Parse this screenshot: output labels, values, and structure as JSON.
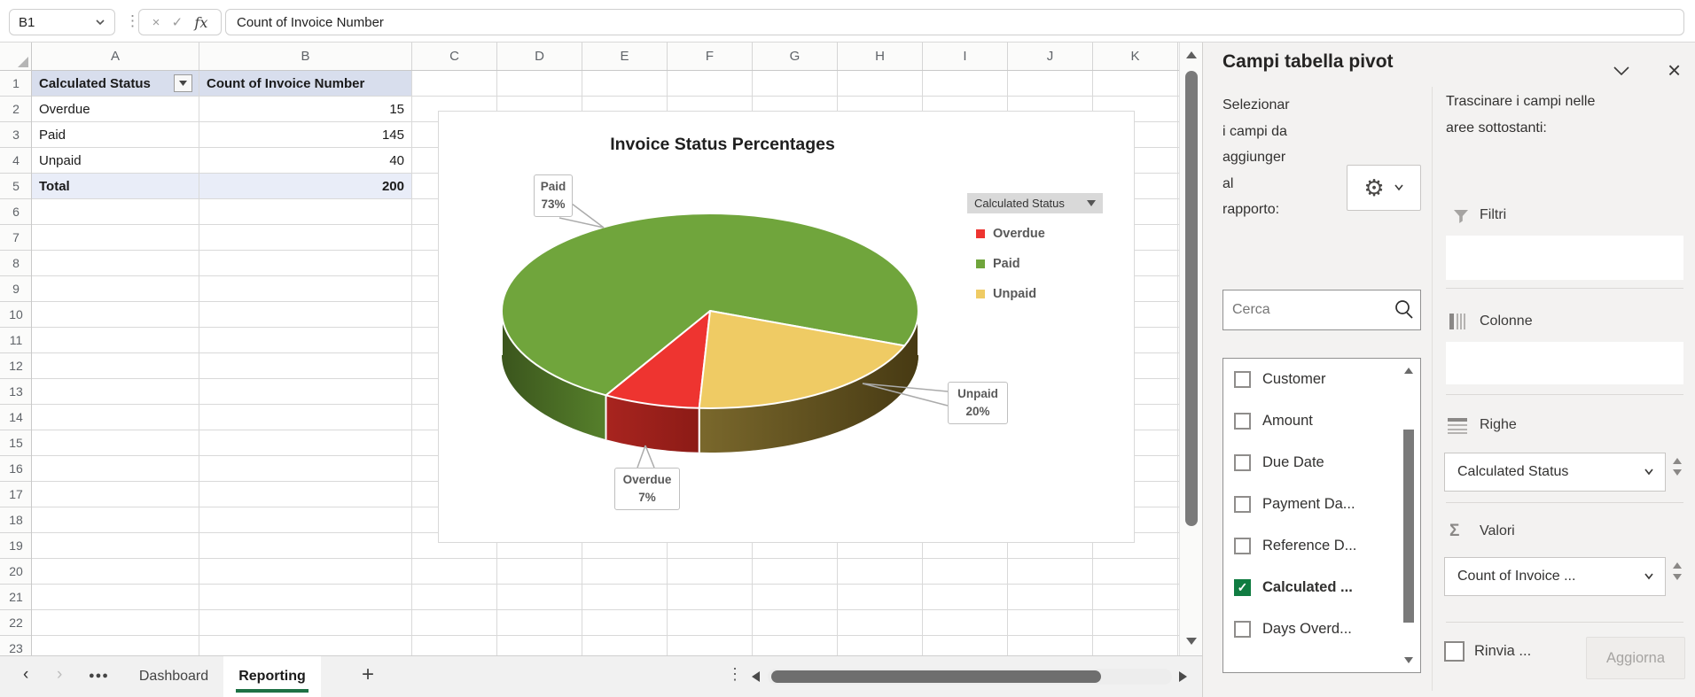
{
  "formula_bar": {
    "cell_ref": "B1",
    "formula": "Count of Invoice Number"
  },
  "grid": {
    "column_letters": [
      "A",
      "B",
      "C",
      "D",
      "E",
      "F",
      "G",
      "H",
      "I",
      "J",
      "K"
    ],
    "row_count": 23,
    "pivot": {
      "header": [
        "Calculated Status",
        "Count of Invoice Number"
      ],
      "rows": [
        [
          "Overdue",
          "15"
        ],
        [
          "Paid",
          "145"
        ],
        [
          "Unpaid",
          "40"
        ]
      ],
      "total": [
        "Total",
        "200"
      ]
    }
  },
  "chart_data": {
    "type": "pie",
    "style": "3d",
    "title": "Invoice Status Percentages",
    "categories": [
      "Overdue",
      "Paid",
      "Unpaid"
    ],
    "values": [
      15,
      145,
      40
    ],
    "percentages_displayed": [
      7,
      73,
      20
    ],
    "colors": [
      "#EE3430",
      "#70A53C",
      "#EFCB64"
    ],
    "start_angle_deg": 183,
    "legend_button": "Calculated Status",
    "legend": [
      "Overdue",
      "Paid",
      "Unpaid"
    ],
    "legend_position": "right",
    "callouts": [
      {
        "label": "Paid",
        "pct": "73%"
      },
      {
        "label": "Overdue",
        "pct": "7%"
      },
      {
        "label": "Unpaid",
        "pct": "20%"
      }
    ]
  },
  "panel": {
    "title": "Campi tabella pivot",
    "intro_left": "Selezionar\ni campi da\naggiunger\nal\nrapporto:",
    "intro_right": "Trascinare i campi nelle\naree sottostanti:",
    "search_placeholder": "Cerca",
    "fields": [
      {
        "label": "Customer",
        "checked": false
      },
      {
        "label": "Amount",
        "checked": false
      },
      {
        "label": "Due Date",
        "checked": false
      },
      {
        "label": "Payment Da...",
        "checked": false
      },
      {
        "label": "Reference D...",
        "checked": false
      },
      {
        "label": "Calculated ...",
        "checked": true
      },
      {
        "label": "Days Overd...",
        "checked": false
      }
    ],
    "areas": {
      "filters_label": "Filtri",
      "columns_label": "Colonne",
      "rows_label": "Righe",
      "values_label": "Valori",
      "rows_chip": "Calculated Status",
      "values_chip": "Count of Invoice ..."
    },
    "defer_label": "Rinvia ...",
    "update_button": "Aggiorna"
  },
  "sheet_bar": {
    "tabs": [
      {
        "label": "Dashboard",
        "active": false
      },
      {
        "label": "Reporting",
        "active": true
      }
    ],
    "add_tab": "+"
  },
  "colors": {
    "accent_green": "#1E7145",
    "checkbox_green": "#107C41",
    "pivot_header_fill": "#D8DEED",
    "pivot_total_fill": "#E9EDF8"
  }
}
